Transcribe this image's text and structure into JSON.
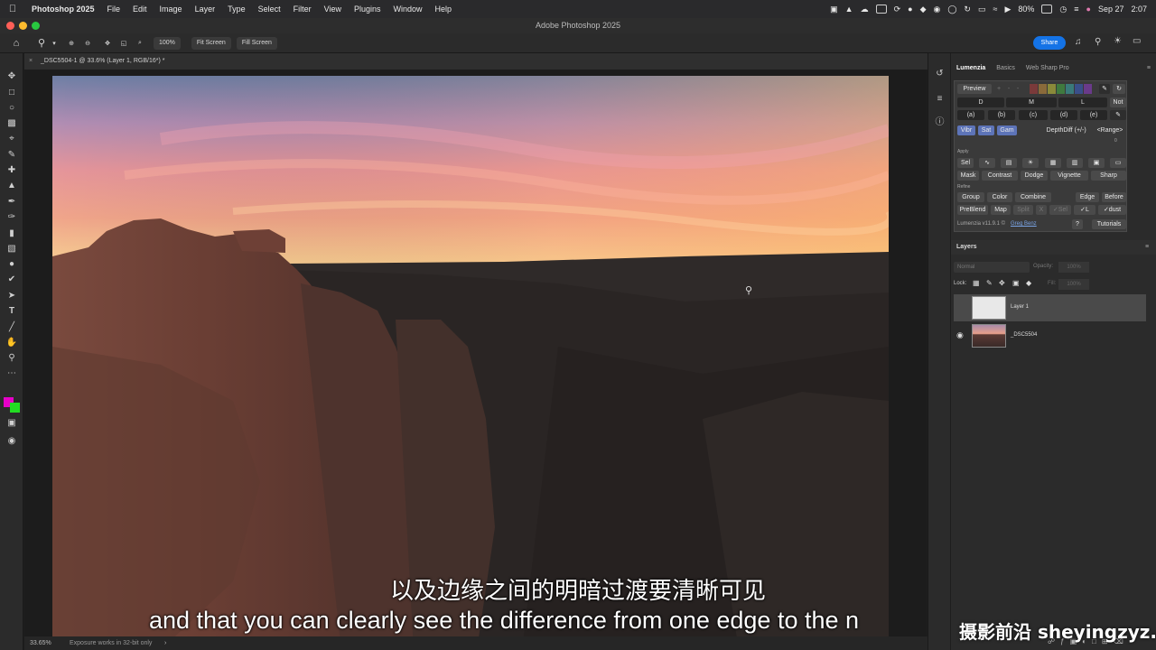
{
  "menubar": {
    "app_name": "Photoshop 2025",
    "items": [
      "File",
      "Edit",
      "Image",
      "Layer",
      "Type",
      "Select",
      "Filter",
      "View",
      "Plugins",
      "Window",
      "Help"
    ],
    "battery": "80%",
    "date": "Sep 27",
    "time": "2:07"
  },
  "window": {
    "title": "Adobe Photoshop 2025"
  },
  "optionsbar": {
    "zoom_value": "100%",
    "fit_screen": "Fit Screen",
    "fill_screen": "Fill Screen",
    "share": "Share"
  },
  "document": {
    "tab_title": "_DSC5504-1 @ 33.6% (Layer 1, RGB/16*) *",
    "zoom_status": "33.65%",
    "status_info": "Exposure works in 32-bit only"
  },
  "subtitles": {
    "chinese": "以及边缘之间的明暗过渡要清晰可见",
    "english": "and that you can clearly see the difference from one edge to the n"
  },
  "watermark": "摄影前沿 sheyingzyz.com",
  "panel_tabs": [
    "Lumenzia",
    "Basics",
    "Web Sharp Pro"
  ],
  "lumenzia": {
    "preview": "Preview",
    "plus": "+",
    "dash1": "-",
    "dash2": "-",
    "dml": [
      "D",
      "M",
      "L"
    ],
    "not_label": "Not",
    "zones": [
      "(a)",
      "(b)",
      "(c)",
      "(d)",
      "(e)"
    ],
    "mods": [
      "Vibr",
      "Sat",
      "Gam"
    ],
    "depth": "Depth",
    "diff": "Diff (+/-)",
    "range": "<Range>",
    "zero": "0",
    "apply_label": "Apply",
    "sel": "Sel",
    "apply_buttons": [
      "Mask",
      "Contrast",
      "Dodge",
      "Vignette",
      "Sharp"
    ],
    "refine_label": "Refine",
    "refine_row1": [
      "Group",
      "Color",
      "Combine",
      "Edge",
      "Before"
    ],
    "refine_row2": [
      "PreBlend",
      "Map",
      "Split",
      "X",
      "✓Sel",
      "✓L",
      "✓dust"
    ],
    "version": "Lumenzia v11.9.1 ©",
    "author": "Greg Benz",
    "help": "?",
    "tutorials": "Tutorials",
    "swatch_colors": [
      "#7a3a3a",
      "#8a6a3a",
      "#8a8a3a",
      "#3f7a3f",
      "#3a7a7a",
      "#3a4f8a",
      "#6a3a8a"
    ]
  },
  "layers": {
    "panel_title": "Layers",
    "blend_mode": "Normal",
    "opacity_label": "Opacity:",
    "opacity_value": "100%",
    "lock_label": "Lock:",
    "fill_label": "Fill:",
    "fill_value": "100%",
    "items": [
      {
        "name": "Layer 1"
      },
      {
        "name": "_DSC5504"
      }
    ]
  },
  "colors": {
    "foreground": "#e600c8",
    "background": "#22dd22",
    "accent": "#1473e6"
  }
}
